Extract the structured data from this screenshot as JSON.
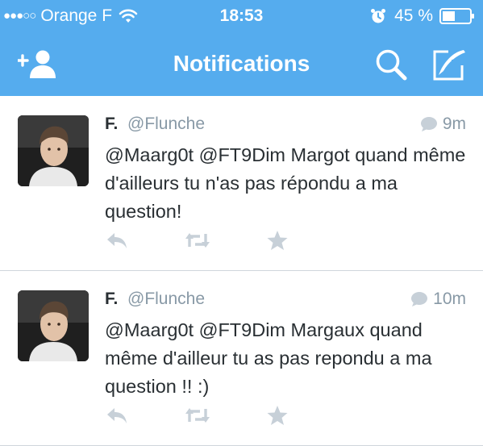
{
  "statusbar": {
    "carrier": "Orange F",
    "time": "18:53",
    "battery": "45 %"
  },
  "navbar": {
    "title": "Notifications"
  },
  "icons": [
    "add-user-icon",
    "search-icon",
    "compose-icon",
    "reply-icon",
    "retweet-icon",
    "favorite-icon",
    "conversation-icon"
  ],
  "colors": {
    "header": "#55ACEE",
    "secondary_text": "#8899a6",
    "action_icons": "#c7d0d8"
  },
  "tweets": [
    {
      "name": "F.",
      "handle": "@Flunche",
      "age": "9m",
      "text": "@Maarg0t @FT9Dim Margot quand même d'ailleurs tu n'as pas répondu a ma question!"
    },
    {
      "name": "F.",
      "handle": "@Flunche",
      "age": "10m",
      "text": "@Maarg0t @FT9Dim Margaux quand même d'ailleur tu as pas repondu a ma question !! :)"
    }
  ]
}
